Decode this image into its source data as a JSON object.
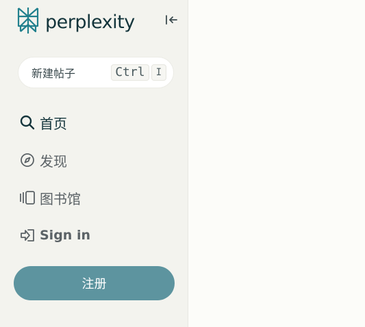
{
  "brand": {
    "name": "perplexity",
    "logo_icon": "perplexity-logo-icon",
    "color": "#13343b"
  },
  "sidebar": {
    "collapse_icon": "collapse-sidebar-icon",
    "new_thread": {
      "label": "新建帖子",
      "shortcut_ctrl": "Ctrl",
      "shortcut_key": "I"
    },
    "nav": [
      {
        "label": "首页",
        "icon": "search-icon",
        "active": true
      },
      {
        "label": "发现",
        "icon": "compass-icon"
      },
      {
        "label": "图书馆",
        "icon": "library-icon"
      },
      {
        "label": "Sign in",
        "icon": "sign-in-icon"
      }
    ],
    "signup": {
      "label": "注册",
      "color": "#5d949f"
    }
  }
}
